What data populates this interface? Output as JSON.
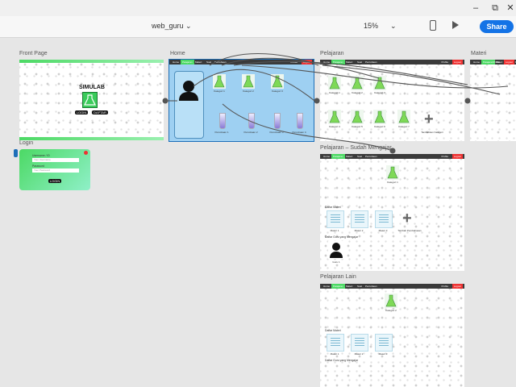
{
  "window": {
    "minimize": "–",
    "maximize": "⧉",
    "close": "✕"
  },
  "toolbar": {
    "doc_title": "web_guru",
    "doc_chevron": "⌄",
    "zoom": "15%",
    "zoom_chevron": "⌄",
    "share_label": "Share",
    "device_icon": "mobile-preview-icon",
    "play_icon": "play-icon"
  },
  "artboards": {
    "front_page": {
      "label": "Front Page",
      "logo_text": "SIMULAB",
      "login_btn": "LOGIN",
      "daftar_btn": "DAFTAR"
    },
    "home": {
      "label": "Home"
    },
    "pelajaran": {
      "label": "Pelajaran"
    },
    "materi": {
      "label": "Materi"
    },
    "login": {
      "label": "Login",
      "username_label": "Username / ID",
      "username_placeholder": "Your Username",
      "password_label": "Password",
      "password_placeholder": "Your Password",
      "submit_btn": "LOGIN"
    },
    "pelajaran_sudah": {
      "label": "Pelajaran – Sudah Mengajar"
    },
    "pelajaran_lain": {
      "label": "Pelajaran Lain"
    }
  },
  "nav_items": [
    "Home",
    "Pelajaran",
    "Materi",
    "Soal",
    "Percobaan"
  ],
  "profile_label": "Profile",
  "logout_label": "Logout",
  "flask_captions": [
    "Kategori 1",
    "Kategori 2",
    "Kategori 3",
    "Kategori 4",
    "Kategori 5",
    "Kategori 6",
    "Kategori 7"
  ],
  "tube_captions": [
    "Percobaan 1",
    "Percobaan 2",
    "Percobaan 3",
    "Percobaan 4"
  ],
  "tambah_label": "Tambahkan Kategori",
  "materi_captions": [
    "Materi 1",
    "Materi 2",
    "Materi 3"
  ],
  "tambah_materi": "Tambah Pembahasan",
  "pengajar_label": "Guru 1",
  "daftar_materi": "Daftar Materi",
  "daftar_guru": "Daftar Guru yang Mengajar",
  "colors": {
    "accent": "#4cd964",
    "share": "#1473e6",
    "home_fill": "#9ed0f2",
    "selection": "#1e6fb8"
  }
}
